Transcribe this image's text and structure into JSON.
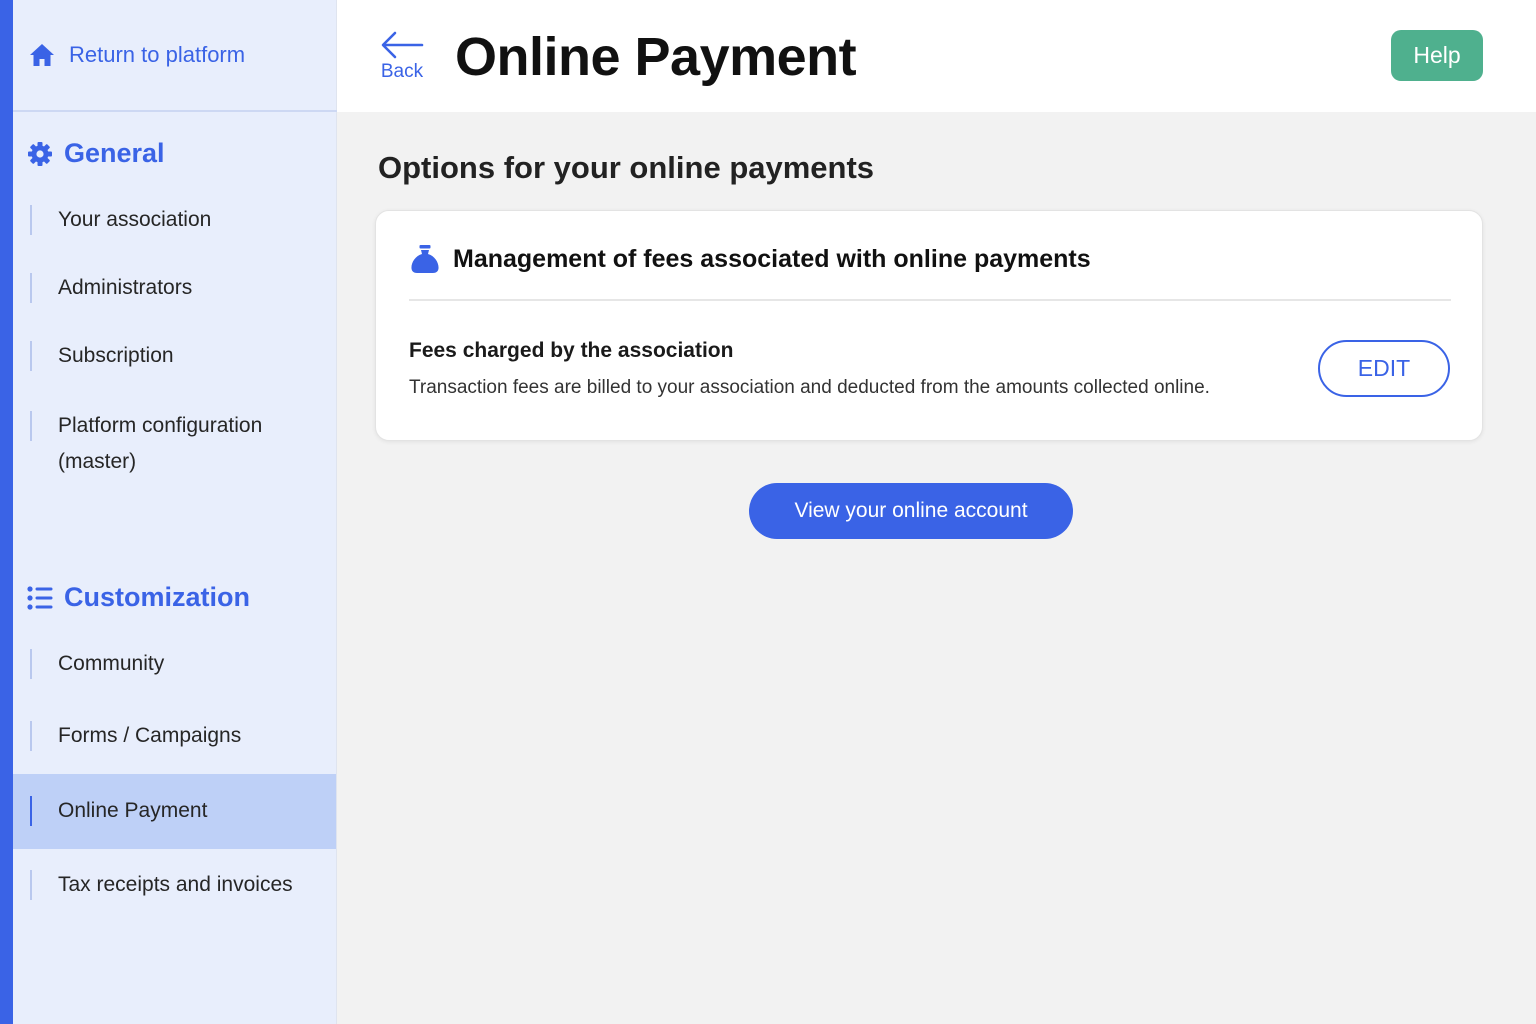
{
  "colors": {
    "accent": "#3a63e6",
    "help": "#4fb08e",
    "sidebar_bg": "#e8eefc",
    "active_bg": "#bed0f7"
  },
  "sidebar": {
    "return_label": "Return to platform",
    "return_icon": "home-icon",
    "general": {
      "label": "General",
      "icon": "gear-icon",
      "items": [
        {
          "label": "Your association"
        },
        {
          "label": "Administrators"
        },
        {
          "label": "Subscription"
        },
        {
          "label": "Platform configuration",
          "label2": "(master)"
        }
      ]
    },
    "customization": {
      "label": "Customization",
      "icon": "list-icon",
      "items": [
        {
          "label": "Community"
        },
        {
          "label": "Forms / Campaigns"
        },
        {
          "label": "Online Payment",
          "active": true
        },
        {
          "label": "Tax receipts and invoices"
        }
      ]
    }
  },
  "header": {
    "back_label": "Back",
    "title": "Online Payment",
    "help_label": "Help"
  },
  "main": {
    "section_title": "Options for your online payments",
    "card": {
      "icon": "money-bag-icon",
      "title": "Management of fees associated with online payments",
      "fee_title": "Fees charged by the association",
      "fee_description": "Transaction fees are billed to your association and deducted from the amounts collected online.",
      "edit_label": "EDIT"
    },
    "view_account_label": "View your online account"
  }
}
